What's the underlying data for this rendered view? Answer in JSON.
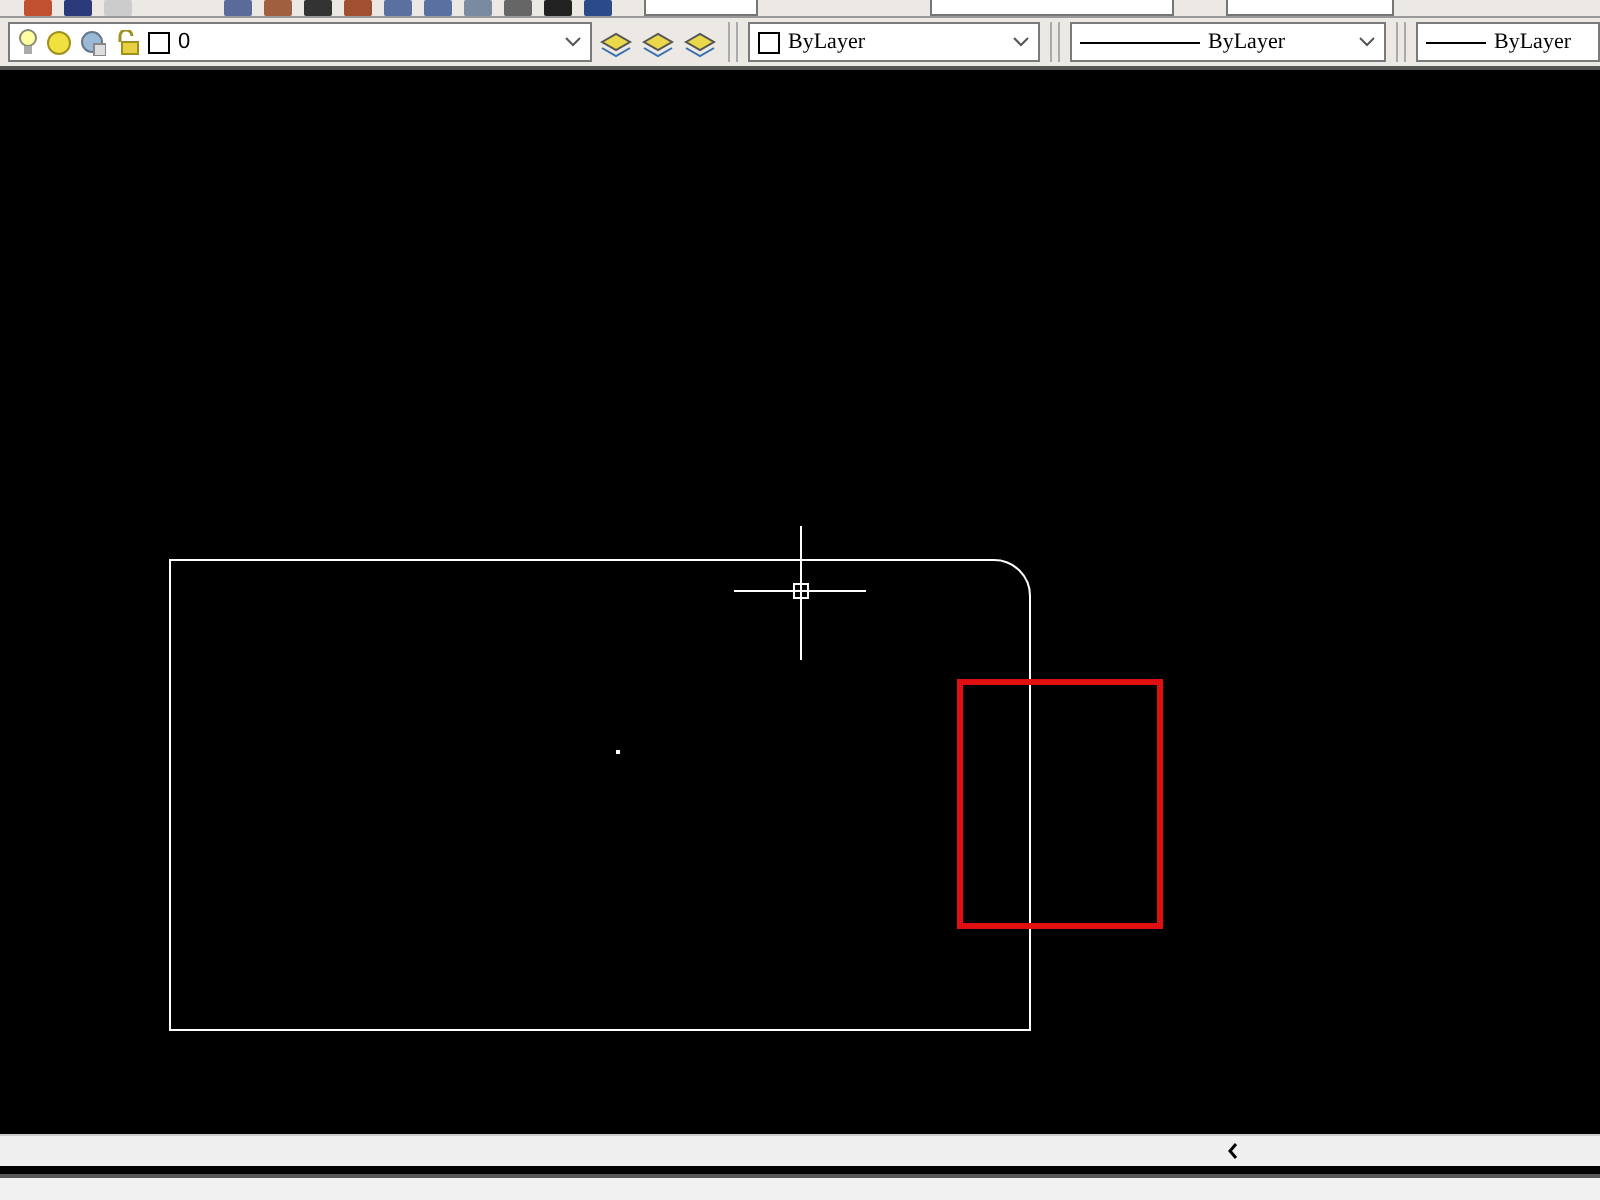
{
  "layers_toolbar": {
    "current_layer": "0"
  },
  "properties_toolbar": {
    "color_control": "ByLayer",
    "linetype": "ByLayer",
    "lineweight": "ByLayer"
  }
}
